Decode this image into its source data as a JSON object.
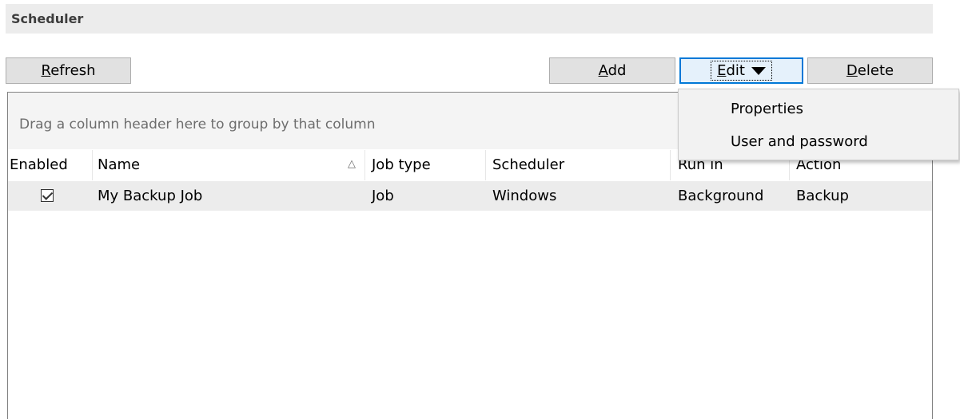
{
  "section": {
    "title": "Scheduler"
  },
  "toolbar": {
    "refresh_label": "Refresh",
    "refresh_accel": "R",
    "refresh_rest": "efresh",
    "add_accel": "A",
    "add_rest": "dd",
    "edit_accel": "E",
    "edit_rest": "dit",
    "delete_accel": "D",
    "delete_rest": "elete"
  },
  "grid": {
    "group_hint": "Drag a column header here to group by that column",
    "columns": [
      "Enabled",
      "Name",
      "Job type",
      "Scheduler",
      "Run in",
      "Action"
    ],
    "sorted_column": "Name",
    "rows": [
      {
        "enabled": true,
        "name": "My Backup Job",
        "job_type": "Job",
        "scheduler": "Windows",
        "run_in": "Background",
        "action": "Backup"
      }
    ]
  },
  "edit_menu": {
    "items": [
      "Properties",
      "User and password"
    ]
  }
}
